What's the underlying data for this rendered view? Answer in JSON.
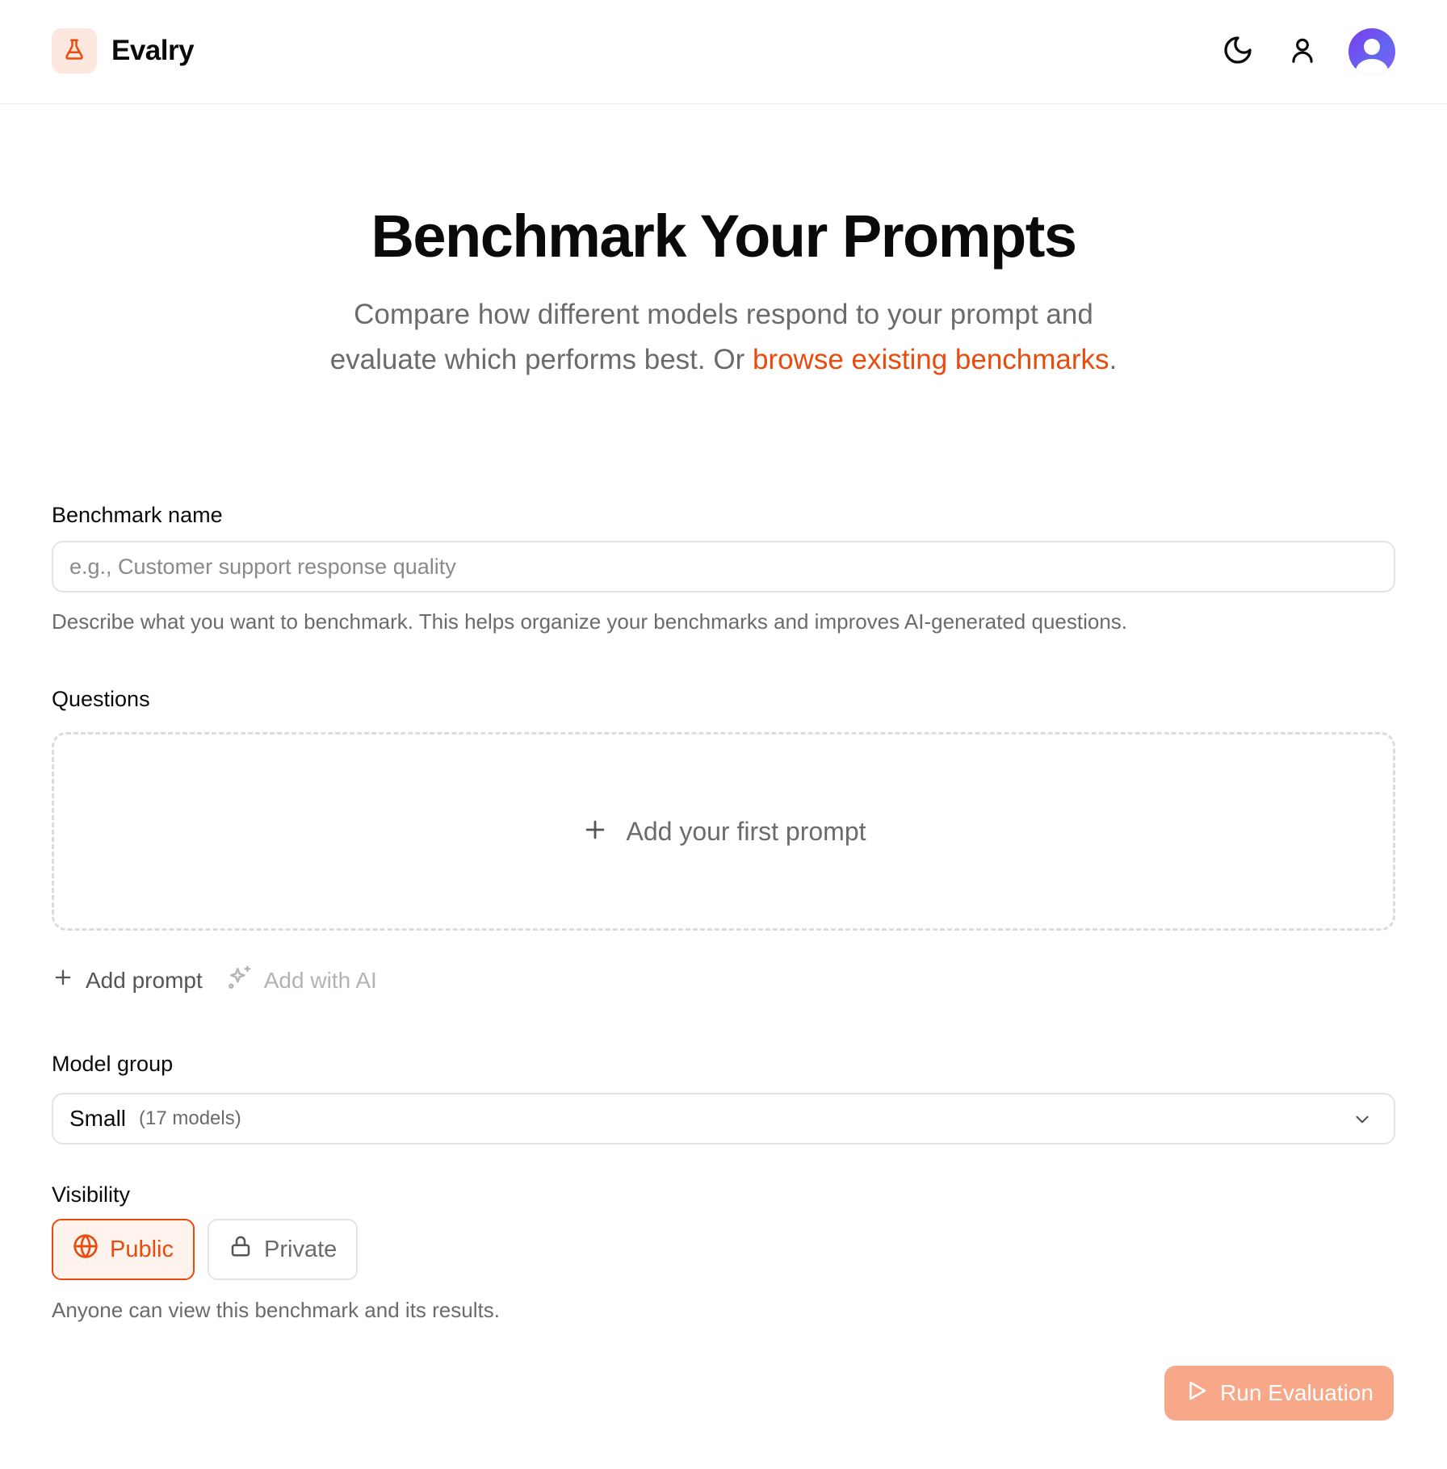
{
  "header": {
    "app_name": "Evalry",
    "logo_icon": "flask-icon",
    "theme_icon": "moon-icon",
    "profile_icon": "user-icon",
    "avatar_icon": "avatar"
  },
  "hero": {
    "title": "Benchmark Your Prompts",
    "subtitle_before": "Compare how different models respond to your prompt and evaluate which performs best. Or ",
    "subtitle_link": "browse existing benchmarks",
    "subtitle_after": "."
  },
  "benchmark_name": {
    "label": "Benchmark name",
    "value": "",
    "placeholder": "e.g., Customer support response quality",
    "help": "Describe what you want to benchmark. This helps organize your benchmarks and improves AI-generated questions."
  },
  "questions": {
    "label": "Questions",
    "empty_cta": "Add your first prompt",
    "add_prompt": "Add prompt",
    "add_with_ai": "Add with AI"
  },
  "model_group": {
    "label": "Model group",
    "selected": "Small",
    "selected_meta": "(17 models)"
  },
  "visibility": {
    "label": "Visibility",
    "options": [
      {
        "label": "Public",
        "icon": "globe-icon",
        "selected": true
      },
      {
        "label": "Private",
        "icon": "lock-icon",
        "selected": false
      }
    ],
    "help": "Anyone can view this benchmark and its results."
  },
  "run": {
    "label": "Run Evaluation",
    "icon": "play-icon"
  },
  "colors": {
    "accent": "#ea4a0c",
    "accent_soft": "#fde7df",
    "run_button": "#f7a889",
    "avatar": "#6366f1"
  }
}
